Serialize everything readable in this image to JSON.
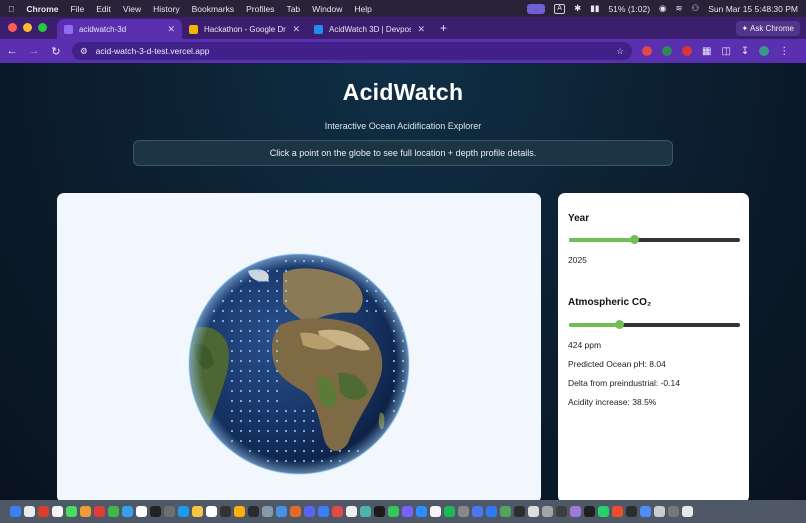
{
  "menubar": {
    "items": [
      "Chrome",
      "File",
      "Edit",
      "View",
      "History",
      "Bookmarks",
      "Profiles",
      "Tab",
      "Window",
      "Help"
    ],
    "status_box": "A",
    "battery": "51% (1:02)",
    "datetime": "Sun Mar 15  5:48:30 PM"
  },
  "tabs": [
    {
      "title": "acidwatch-3d",
      "active": true,
      "favicon_color": "#8f6cf0"
    },
    {
      "title": "Hackathon - Google Drive",
      "active": false,
      "favicon_color": "#f4b400"
    },
    {
      "title": "AcidWatch 3D | Devpost",
      "active": false,
      "favicon_color": "#1f8cf0"
    }
  ],
  "ask_chrome": "Ask Chrome",
  "address": {
    "url": "acid-watch-3-d-test.vercel.app"
  },
  "page": {
    "title": "AcidWatch",
    "subtitle": "Interactive Ocean Acidification Explorer",
    "hint": "Click a point on the globe to see full location + depth profile details."
  },
  "controls": {
    "year_label": "Year",
    "year_value": "2025",
    "year_fraction": 0.38,
    "co2_label": "Atmospheric CO₂",
    "co2_value": "424 ppm",
    "co2_fraction": 0.29,
    "predicted_ph": "Predicted Ocean pH: 8.04",
    "delta": "Delta from preindustrial: -0.14",
    "acidity": "Acidity increase: 38.5%",
    "accent_color": "#6fbf56"
  },
  "dock_icon_colors": [
    "#3b7ff5",
    "#e9e9ee",
    "#d9402c",
    "#f6f6f6",
    "#4cd964",
    "#f29c38",
    "#e23b3b",
    "#43b649",
    "#39a0ed",
    "#ffffff",
    "#222222",
    "#6e6e6e",
    "#1d9bf0",
    "#f5c543",
    "#ffffff",
    "#333333",
    "#ffb000",
    "#2b2b2b",
    "#8899aa",
    "#4a90e2",
    "#e06c2c",
    "#5865f2",
    "#3c7ef7",
    "#e24a4a",
    "#f1f1f1",
    "#4db6ac",
    "#1b1b1b",
    "#35c759",
    "#7b61ff",
    "#2d8cff",
    "#f5f5f5",
    "#1db954",
    "#888888",
    "#4b77f0",
    "#2e7bf6",
    "#58a35c",
    "#2c2c2c",
    "#dddddd",
    "#a5a5a5",
    "#3d3d3d",
    "#9c7bd8",
    "#1f1f1f",
    "#25d366",
    "#ee4d2d",
    "#2d2d2d",
    "#4d8df7",
    "#cccccc",
    "#777777",
    "#e8e8e8"
  ]
}
